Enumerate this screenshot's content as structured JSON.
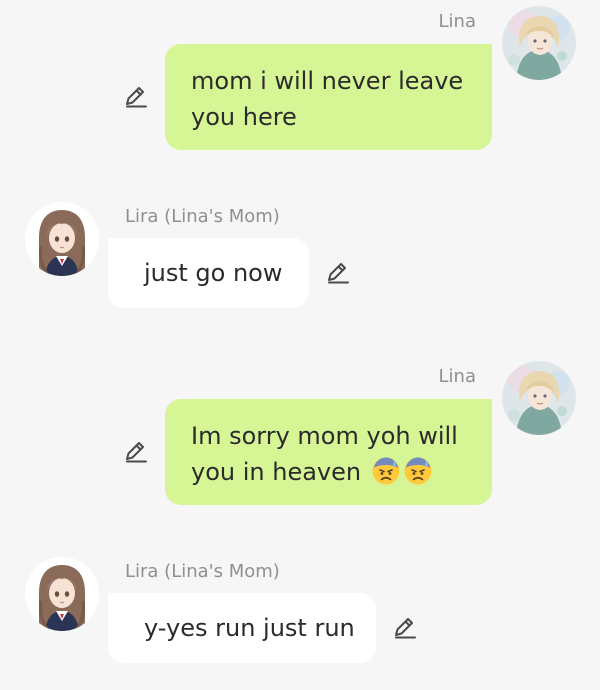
{
  "messages": [
    {
      "sender": "Lina",
      "text": "mom i will never leave",
      "text2": "you here"
    },
    {
      "sender": "Lira (Lina's Mom)",
      "text": "just go now"
    },
    {
      "sender": "Lina",
      "text": "Im sorry mom yoh will",
      "text2": "you in heaven",
      "emoji": [
        "downcast-face-with-sweat",
        "downcast-face-with-sweat"
      ]
    },
    {
      "sender": "Lira (Lina's Mom)",
      "text": "y-yes run just run"
    }
  ],
  "colors": {
    "background": "#f6f6f6",
    "user_bubble": "#d6f595",
    "bot_bubble": "#ffffff",
    "sender_text": "#8f8f8f",
    "message_text": "#2b2b2b"
  },
  "icons": {
    "edit": "pencil-icon",
    "user_avatar": "lina-avatar",
    "bot_avatar": "lira-avatar"
  }
}
